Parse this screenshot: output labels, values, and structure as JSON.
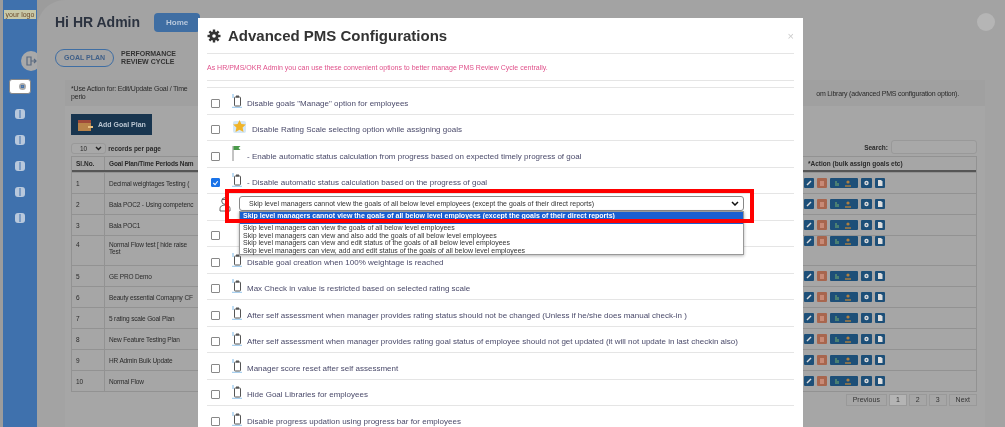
{
  "sidebar": {
    "logo": "your logo"
  },
  "header": {
    "greeting": "Hi HR Admin",
    "home_button": "Home"
  },
  "tabs": [
    {
      "label": "GOAL PLAN",
      "selected": true
    },
    {
      "label": "PERFORMANCE REVIEW CYCLE",
      "selected": false
    }
  ],
  "notice": [
    "*Use Action for: Edit/Update Goal / Time perio",
    "om Library (advanced PMS configuration option)."
  ],
  "add_button": "Add Goal Plan",
  "page_size": {
    "value": "10",
    "label": "records per page"
  },
  "search": {
    "label": "Search:"
  },
  "table": {
    "columns": [
      "Sl.No.",
      "Goal Plan/Time Periods Nam",
      "*Action (bulk assign goals etc)"
    ],
    "rows": [
      {
        "no": "1",
        "name": [
          "Decimal weightages Testing ("
        ]
      },
      {
        "no": "2",
        "name": [
          "Bala POC2 - Using competenc"
        ]
      },
      {
        "no": "3",
        "name": [
          "Bala POC1"
        ]
      },
      {
        "no": "4",
        "name": [
          "Normal Flow test [ hide raise",
          "Test"
        ]
      },
      {
        "no": "5",
        "name": [
          "GE PRO Demo"
        ]
      },
      {
        "no": "6",
        "name": [
          "Beauty essential Comapny CF"
        ]
      },
      {
        "no": "7",
        "name": [
          "5 rating scale Goal Plan"
        ]
      },
      {
        "no": "8",
        "name": [
          "New Feature Testing Plan"
        ]
      },
      {
        "no": "9",
        "name": [
          "HR Admin Bulk Update"
        ]
      },
      {
        "no": "10",
        "name": [
          "Normal Flow"
        ]
      }
    ]
  },
  "pagination": [
    {
      "label": "Previous",
      "selected": false
    },
    {
      "label": "1",
      "selected": true
    },
    {
      "label": "2",
      "selected": false
    },
    {
      "label": "3",
      "selected": false
    },
    {
      "label": "Next",
      "selected": false
    }
  ],
  "modal": {
    "title": "Advanced PMS Configurations",
    "close": "×",
    "subtitle": "As HR/PMS/OKR Admin you can use these convenient options to better manage PMS Review Cycle centrally.",
    "options": [
      {
        "kind": "clipboard",
        "checked": false,
        "label": "Disable goals \"Manage\" option for employees"
      },
      {
        "kind": "star",
        "checked": false,
        "label": "Disable Rating Scale selecting option while assigning goals"
      },
      {
        "kind": "flag",
        "checked": false,
        "label": "- Enable automatic status calculation from progress based on expected timely progress of goal"
      },
      {
        "kind": "clipboard",
        "checked": true,
        "label": "- Disable automatic status calculation based on the progress of goal"
      },
      {
        "kind": "select",
        "value": "Skip level managers cannot view the goals of all below level employees (except the goals of their direct reports)",
        "choices": [
          {
            "label": "Skip level managers cannot view the goals of all below level employees (except the goals of their direct reports)",
            "selected": true
          },
          {
            "label": "Skip level managers can view the goals of all below level employees",
            "selected": false
          },
          {
            "label": "Skip level managers can view and also add the goals of all below level employees",
            "selected": false
          },
          {
            "label": "Skip level managers can view and edit status of the goals of all below level employees",
            "selected": false
          },
          {
            "label": "Skip level managers can view, add and edit status of the goals of all below level employees",
            "selected": false
          }
        ]
      },
      {
        "kind": "hidden",
        "checked": false
      },
      {
        "kind": "clipboard",
        "checked": false,
        "label": "Disable goal creation when 100% weightage is reached"
      },
      {
        "kind": "clipboard",
        "checked": false,
        "label": "Max Check in value is restricted based on selected rating scale"
      },
      {
        "kind": "clipboard",
        "checked": false,
        "label": "After self assessment when manager provides rating status should not be changed (Unless if he/she does manual check-in )"
      },
      {
        "kind": "clipboard",
        "checked": false,
        "label": "After self assessment when manager provides rating goal status of employee should not get updated (it will not update in last checkin also)"
      },
      {
        "kind": "clipboard",
        "checked": false,
        "label": "Manager score reset after self assessment"
      },
      {
        "kind": "clipboard",
        "checked": false,
        "label": "Hide Goal Libraries for employees"
      },
      {
        "kind": "clipboard",
        "checked": false,
        "label": "Disable progress updation using progress bar for employees"
      }
    ]
  }
}
